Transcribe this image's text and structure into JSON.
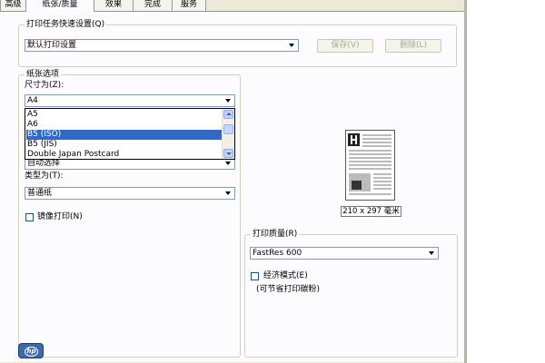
{
  "tabs": [
    "高级",
    "纸张/质量",
    "效果",
    "完成",
    "服务"
  ],
  "quick_set": {
    "legend": "打印任务快速设置(Q)",
    "value": "默认打印设置",
    "save_label": "保存(V)",
    "delete_label": "删除(L)"
  },
  "paper": {
    "legend": "纸张选项",
    "size_label": "尺寸为(Z):",
    "size_value": "A4",
    "size_options": [
      "A5",
      "A6",
      "B5 (ISO)",
      "B5 (JIS)",
      "Double Japan Postcard"
    ],
    "size_selected": "B5 (ISO)",
    "source_value": "自动选择",
    "type_label": "类型为(T):",
    "type_value": "普通纸",
    "mirror_label": "镜像打印(N)"
  },
  "preview": {
    "size_text": "210 x 297 毫米"
  },
  "quality": {
    "legend": "打印质量(R)",
    "value": "FastRes 600",
    "econo_label": "经济模式(E)",
    "econo_note": "(可节省打印碳粉)"
  },
  "footer": {
    "logo_icon": "hp-logo-icon"
  }
}
